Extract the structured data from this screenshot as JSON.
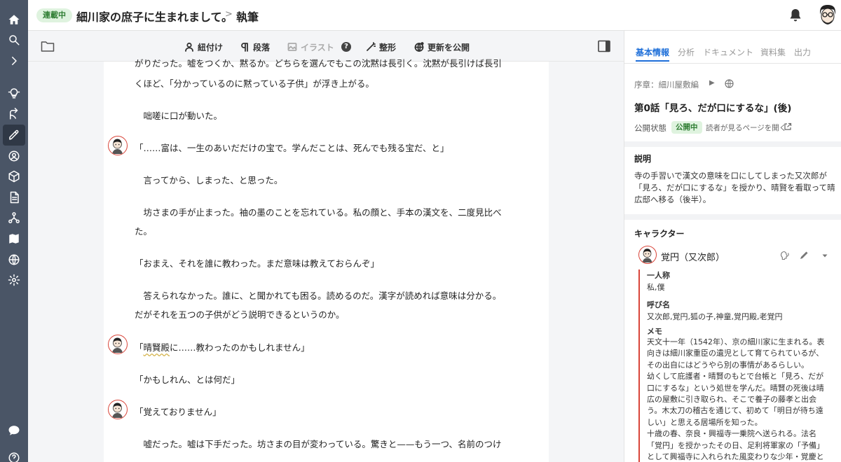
{
  "header": {
    "status_badge": "連載中",
    "story_title": "細川家の庶子に生まれまして。",
    "breadcrumb_sep": ">",
    "breadcrumb_current": "執筆"
  },
  "rail": {
    "icons": [
      "home-icon",
      "search-icon",
      "expand-icon",
      "lightbulb-icon",
      "branch-icon",
      "pen-icon",
      "person-icon",
      "cube-icon",
      "document-icon",
      "network-icon",
      "map-icon",
      "globe-icon",
      "gear-icon",
      "chat-icon",
      "help-icon"
    ],
    "active": "pen-icon"
  },
  "toolbar": {
    "ruby_label": "紐付け",
    "paragraph_label": "段落",
    "illust_label": "イラスト",
    "format_label": "整形",
    "publish_label": "更新を公開"
  },
  "editor": {
    "lines": [
      "がりだった。嘘をつくか、黙るか。どちらを選んでもこの沈黙は長引く。沈黙が長引けば長引",
      "くほど、「分かっているのに黙っている子供」が浮き上がる。",
      "　咄嗟に口が動いた。",
      "「……富は、一生のあいだだけの宝で。学んだことは、死んでも残る宝だ、と」",
      "　言ってから、しまった、と思った。",
      "　坊さまの手が止まった。袖の墨のことを忘れている。私の顔と、手本の漢文を、二度見比べ",
      "た。",
      "「おまえ、それを誰に教わった。まだ意味は教えておらんぞ」",
      "　答えられなかった。誰に、と聞かれても困る。読めるのだ。漢字が読めれば意味は分かる。",
      "だがそれを五つの子供がどう説明できるというのか。",
      "「",
      "晴賢殿",
      "に……教わったのかもしれません」",
      "「かもしれん、とは何だ」",
      "「覚えておりません」",
      "　嘘だった。嘘は下手だった。坊さまの目が変わっている。驚きと——もう一つ、名前のつけ"
    ]
  },
  "panel": {
    "tabs": [
      "基本情報",
      "分析",
      "ドキュメント",
      "資料集",
      "出力"
    ],
    "active_tab": "基本情報",
    "chapter": "序章：細川屋敷編",
    "episode_title": "第0話「見ろ、だが口にするな」(後)",
    "pub_status_label": "公開状態",
    "pub_status_value": "公開中",
    "reader_link": "読者が見るページを開く",
    "description_heading": "説明",
    "description": "寺の手習いで漢文の意味を口にしてしまった又次郎が「見ろ、だが口にするな」を授かり、晴賢を看取って晴広邸へ移る（後半）。",
    "characters_heading": "キャラクター",
    "character": {
      "name": "覚円（又次郎）",
      "first_person_label": "一人称",
      "first_person_value": "私,僕",
      "called_label": "呼び名",
      "called_value": "又次郎,覚円,狐の子,神童,覚円殿,老覚円",
      "memo_label": "メモ",
      "memo_lines": [
        "天文十一年（1542年）、京の細川家に生まれる。表",
        "向きは細川家重臣の遺児として育てられているが、",
        "その出自にはどうやら別の事情があるらしい。",
        "幼くして庇護者・晴賢のもとで台帳と「見ろ、だが",
        "口にするな」という処世を学んだ。晴賢の死後は晴",
        "広の屋敷に引き取られ、そこで養子の藤孝と出会",
        "う。木太刀の稽古を通じて、初めて「明日が待ち遠",
        "しい」と思える居場所を知った。",
        "十歳の春、奈良・興福寺一乗院へ送られる。法名",
        "「覚円」を授かったその日、足利将軍家の「予備」",
        "として興福寺に入れられた風変わりな少年・覚慶と"
      ]
    }
  },
  "colors": {
    "rail_bg": "#4a5566",
    "accent_blue": "#1e6fd9",
    "status_green": "#2e7d32",
    "status_green_bg": "#dff3df",
    "character_red": "#d9453a"
  }
}
